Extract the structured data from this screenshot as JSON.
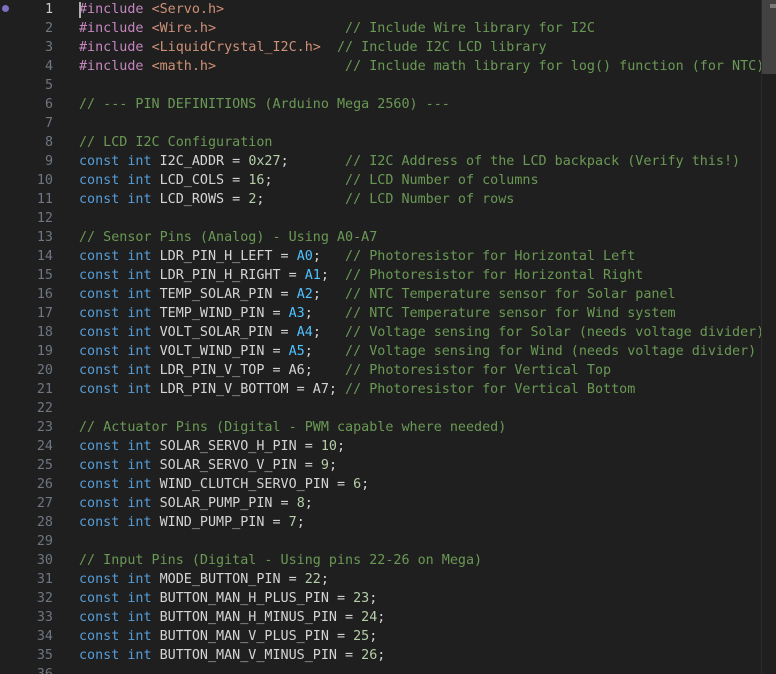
{
  "editor": {
    "active_line": 1,
    "lines": [
      {
        "n": "1",
        "tokens": [
          {
            "t": "pre",
            "s": "#include "
          },
          {
            "t": "str",
            "s": "<Servo.h>"
          }
        ]
      },
      {
        "n": "2",
        "tokens": [
          {
            "t": "pre",
            "s": "#include "
          },
          {
            "t": "str",
            "s": "<Wire.h>"
          },
          {
            "t": "cmt",
            "s": "                // Include Wire library for I2C"
          }
        ]
      },
      {
        "n": "3",
        "tokens": [
          {
            "t": "pre",
            "s": "#include "
          },
          {
            "t": "str",
            "s": "<LiquidCrystal_I2C.h>"
          },
          {
            "t": "cmt",
            "s": "  // Include I2C LCD library"
          }
        ]
      },
      {
        "n": "4",
        "tokens": [
          {
            "t": "pre",
            "s": "#include "
          },
          {
            "t": "str",
            "s": "<math.h>"
          },
          {
            "t": "cmt",
            "s": "                // Include math library for log() function (for NTC)"
          }
        ]
      },
      {
        "n": "5",
        "tokens": []
      },
      {
        "n": "6",
        "tokens": [
          {
            "t": "cmt",
            "s": "// --- PIN DEFINITIONS (Arduino Mega 2560) ---"
          }
        ]
      },
      {
        "n": "7",
        "tokens": []
      },
      {
        "n": "8",
        "tokens": [
          {
            "t": "cmt",
            "s": "// LCD I2C Configuration"
          }
        ]
      },
      {
        "n": "9",
        "tokens": [
          {
            "t": "kw",
            "s": "const int "
          },
          {
            "t": "id",
            "s": "I2C_ADDR = "
          },
          {
            "t": "num",
            "s": "0x27"
          },
          {
            "t": "id",
            "s": ";"
          },
          {
            "t": "cmt",
            "s": "       // I2C Address of the LCD backpack (Verify this!)"
          }
        ]
      },
      {
        "n": "10",
        "tokens": [
          {
            "t": "kw",
            "s": "const int "
          },
          {
            "t": "id",
            "s": "LCD_COLS = "
          },
          {
            "t": "num",
            "s": "16"
          },
          {
            "t": "id",
            "s": ";"
          },
          {
            "t": "cmt",
            "s": "         // LCD Number of columns"
          }
        ]
      },
      {
        "n": "11",
        "tokens": [
          {
            "t": "kw",
            "s": "const int "
          },
          {
            "t": "id",
            "s": "LCD_ROWS = "
          },
          {
            "t": "num",
            "s": "2"
          },
          {
            "t": "id",
            "s": ";"
          },
          {
            "t": "cmt",
            "s": "          // LCD Number of rows"
          }
        ]
      },
      {
        "n": "12",
        "tokens": []
      },
      {
        "n": "13",
        "tokens": [
          {
            "t": "cmt",
            "s": "// Sensor Pins (Analog) - Using A0-A7"
          }
        ]
      },
      {
        "n": "14",
        "tokens": [
          {
            "t": "kw",
            "s": "const int "
          },
          {
            "t": "id",
            "s": "LDR_PIN_H_LEFT = "
          },
          {
            "t": "pin",
            "s": "A0"
          },
          {
            "t": "id",
            "s": ";"
          },
          {
            "t": "cmt",
            "s": "   // Photoresistor for Horizontal Left"
          }
        ]
      },
      {
        "n": "15",
        "tokens": [
          {
            "t": "kw",
            "s": "const int "
          },
          {
            "t": "id",
            "s": "LDR_PIN_H_RIGHT = "
          },
          {
            "t": "pin",
            "s": "A1"
          },
          {
            "t": "id",
            "s": ";"
          },
          {
            "t": "cmt",
            "s": "  // Photoresistor for Horizontal Right"
          }
        ]
      },
      {
        "n": "16",
        "tokens": [
          {
            "t": "kw",
            "s": "const int "
          },
          {
            "t": "id",
            "s": "TEMP_SOLAR_PIN = "
          },
          {
            "t": "pin",
            "s": "A2"
          },
          {
            "t": "id",
            "s": ";"
          },
          {
            "t": "cmt",
            "s": "   // NTC Temperature sensor for Solar panel"
          }
        ]
      },
      {
        "n": "17",
        "tokens": [
          {
            "t": "kw",
            "s": "const int "
          },
          {
            "t": "id",
            "s": "TEMP_WIND_PIN = "
          },
          {
            "t": "pin",
            "s": "A3"
          },
          {
            "t": "id",
            "s": ";"
          },
          {
            "t": "cmt",
            "s": "    // NTC Temperature sensor for Wind system"
          }
        ]
      },
      {
        "n": "18",
        "tokens": [
          {
            "t": "kw",
            "s": "const int "
          },
          {
            "t": "id",
            "s": "VOLT_SOLAR_PIN = "
          },
          {
            "t": "pin",
            "s": "A4"
          },
          {
            "t": "id",
            "s": ";"
          },
          {
            "t": "cmt",
            "s": "   // Voltage sensing for Solar (needs voltage divider)"
          }
        ]
      },
      {
        "n": "19",
        "tokens": [
          {
            "t": "kw",
            "s": "const int "
          },
          {
            "t": "id",
            "s": "VOLT_WIND_PIN = "
          },
          {
            "t": "pin",
            "s": "A5"
          },
          {
            "t": "id",
            "s": ";"
          },
          {
            "t": "cmt",
            "s": "    // Voltage sensing for Wind (needs voltage divider)"
          }
        ]
      },
      {
        "n": "20",
        "tokens": [
          {
            "t": "kw",
            "s": "const int "
          },
          {
            "t": "id",
            "s": "LDR_PIN_V_TOP = A6;"
          },
          {
            "t": "cmt",
            "s": "    // Photoresistor for Vertical Top"
          }
        ]
      },
      {
        "n": "21",
        "tokens": [
          {
            "t": "kw",
            "s": "const int "
          },
          {
            "t": "id",
            "s": "LDR_PIN_V_BOTTOM = A7;"
          },
          {
            "t": "cmt",
            "s": " // Photoresistor for Vertical Bottom"
          }
        ]
      },
      {
        "n": "22",
        "tokens": []
      },
      {
        "n": "23",
        "tokens": [
          {
            "t": "cmt",
            "s": "// Actuator Pins (Digital - PWM capable where needed)"
          }
        ]
      },
      {
        "n": "24",
        "tokens": [
          {
            "t": "kw",
            "s": "const int "
          },
          {
            "t": "id",
            "s": "SOLAR_SERVO_H_PIN = "
          },
          {
            "t": "num",
            "s": "10"
          },
          {
            "t": "id",
            "s": ";"
          }
        ]
      },
      {
        "n": "25",
        "tokens": [
          {
            "t": "kw",
            "s": "const int "
          },
          {
            "t": "id",
            "s": "SOLAR_SERVO_V_PIN = "
          },
          {
            "t": "num",
            "s": "9"
          },
          {
            "t": "id",
            "s": ";"
          }
        ]
      },
      {
        "n": "26",
        "tokens": [
          {
            "t": "kw",
            "s": "const int "
          },
          {
            "t": "id",
            "s": "WIND_CLUTCH_SERVO_PIN = "
          },
          {
            "t": "num",
            "s": "6"
          },
          {
            "t": "id",
            "s": ";"
          }
        ]
      },
      {
        "n": "27",
        "tokens": [
          {
            "t": "kw",
            "s": "const int "
          },
          {
            "t": "id",
            "s": "SOLAR_PUMP_PIN = "
          },
          {
            "t": "num",
            "s": "8"
          },
          {
            "t": "id",
            "s": ";"
          }
        ]
      },
      {
        "n": "28",
        "tokens": [
          {
            "t": "kw",
            "s": "const int "
          },
          {
            "t": "id",
            "s": "WIND_PUMP_PIN = "
          },
          {
            "t": "num",
            "s": "7"
          },
          {
            "t": "id",
            "s": ";"
          }
        ]
      },
      {
        "n": "29",
        "tokens": []
      },
      {
        "n": "30",
        "tokens": [
          {
            "t": "cmt",
            "s": "// Input Pins (Digital - Using pins 22-26 on Mega)"
          }
        ]
      },
      {
        "n": "31",
        "tokens": [
          {
            "t": "kw",
            "s": "const int "
          },
          {
            "t": "id",
            "s": "MODE_BUTTON_PIN = "
          },
          {
            "t": "num",
            "s": "22"
          },
          {
            "t": "id",
            "s": ";"
          }
        ]
      },
      {
        "n": "32",
        "tokens": [
          {
            "t": "kw",
            "s": "const int "
          },
          {
            "t": "id",
            "s": "BUTTON_MAN_H_PLUS_PIN = "
          },
          {
            "t": "num",
            "s": "23"
          },
          {
            "t": "id",
            "s": ";"
          }
        ]
      },
      {
        "n": "33",
        "tokens": [
          {
            "t": "kw",
            "s": "const int "
          },
          {
            "t": "id",
            "s": "BUTTON_MAN_H_MINUS_PIN = "
          },
          {
            "t": "num",
            "s": "24"
          },
          {
            "t": "id",
            "s": ";"
          }
        ]
      },
      {
        "n": "34",
        "tokens": [
          {
            "t": "kw",
            "s": "const int "
          },
          {
            "t": "id",
            "s": "BUTTON_MAN_V_PLUS_PIN = "
          },
          {
            "t": "num",
            "s": "25"
          },
          {
            "t": "id",
            "s": ";"
          }
        ]
      },
      {
        "n": "35",
        "tokens": [
          {
            "t": "kw",
            "s": "const int "
          },
          {
            "t": "id",
            "s": "BUTTON_MAN_V_MINUS_PIN = "
          },
          {
            "t": "num",
            "s": "26"
          },
          {
            "t": "id",
            "s": ";"
          }
        ]
      },
      {
        "n": "36",
        "tokens": []
      }
    ]
  },
  "colors": {
    "background": "#1f1f1f",
    "preprocessor": "#c586c0",
    "string": "#ce9178",
    "comment": "#6a9955",
    "keyword": "#569cd6",
    "identifier": "#d4d4d4",
    "number": "#b5cea8",
    "analog_pin": "#4fc1ff",
    "line_number": "#6e7681",
    "active_line_number": "#cccccc"
  }
}
